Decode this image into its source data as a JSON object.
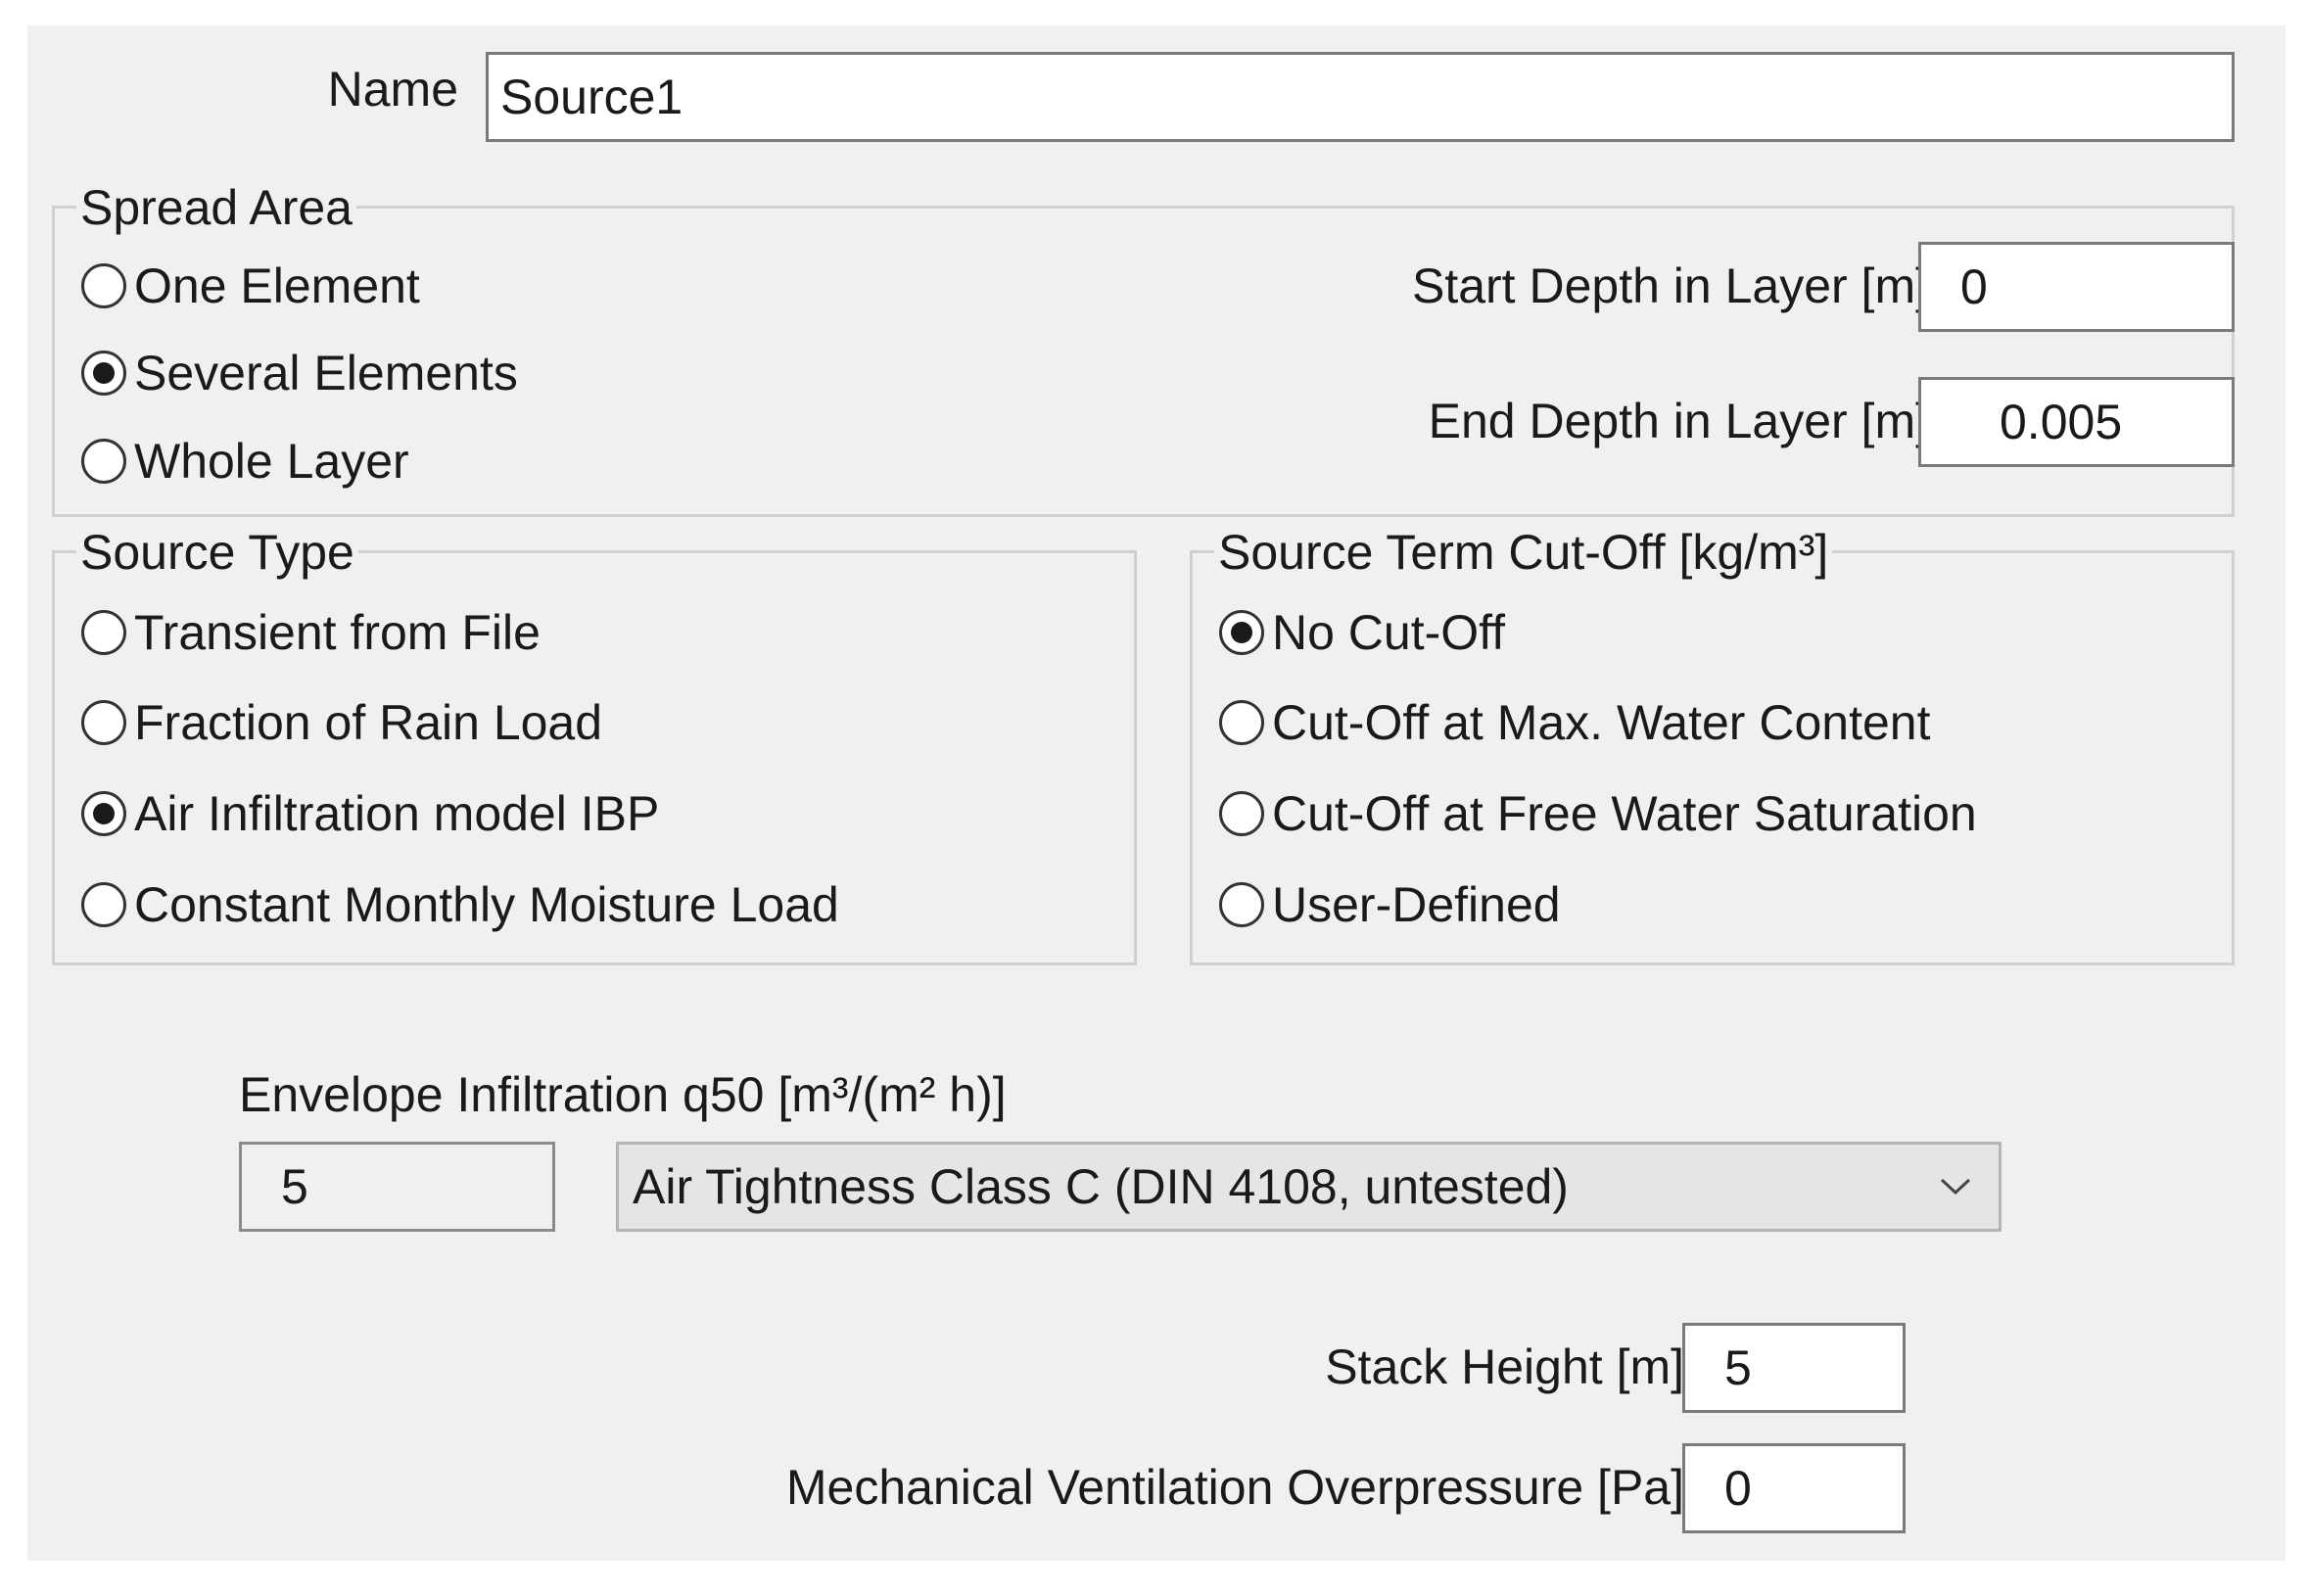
{
  "name_field": {
    "label": "Name",
    "value": "Source1"
  },
  "spread_area": {
    "title": "Spread Area",
    "options": [
      {
        "label": "One Element",
        "selected": false
      },
      {
        "label": "Several Elements",
        "selected": true
      },
      {
        "label": "Whole Layer",
        "selected": false
      }
    ],
    "start_depth": {
      "label": "Start Depth in Layer [m]",
      "value": "0"
    },
    "end_depth": {
      "label": "End Depth in Layer [m]",
      "value": "0.005"
    }
  },
  "source_type": {
    "title": "Source Type",
    "options": [
      {
        "label": "Transient from File",
        "selected": false
      },
      {
        "label": "Fraction of Rain Load",
        "selected": false
      },
      {
        "label": "Air Infiltration model IBP",
        "selected": true
      },
      {
        "label": "Constant Monthly Moisture Load",
        "selected": false
      }
    ]
  },
  "cut_off": {
    "title": "Source Term Cut-Off [kg/m³]",
    "options": [
      {
        "label": "No Cut-Off",
        "selected": true
      },
      {
        "label": "Cut-Off at Max. Water Content",
        "selected": false
      },
      {
        "label": "Cut-Off at Free Water Saturation",
        "selected": false
      },
      {
        "label": "User-Defined",
        "selected": false
      }
    ]
  },
  "infiltration": {
    "label": "Envelope Infiltration q50 [m³/(m² h)]",
    "value": "5",
    "class_select": "Air Tightness Class C (DIN 4108, untested)"
  },
  "stack_height": {
    "label": "Stack Height [m]",
    "value": "5"
  },
  "overpressure": {
    "label": "Mechanical Ventilation Overpressure [Pa]",
    "value": "0"
  },
  "icons": {
    "radio": "radio-button",
    "dropdown": "chevron-down-icon"
  },
  "colors": {
    "dialog_background": "#f0f0f0",
    "textbox_background": "#ffffff",
    "combo_background": "#e5e5e5"
  }
}
